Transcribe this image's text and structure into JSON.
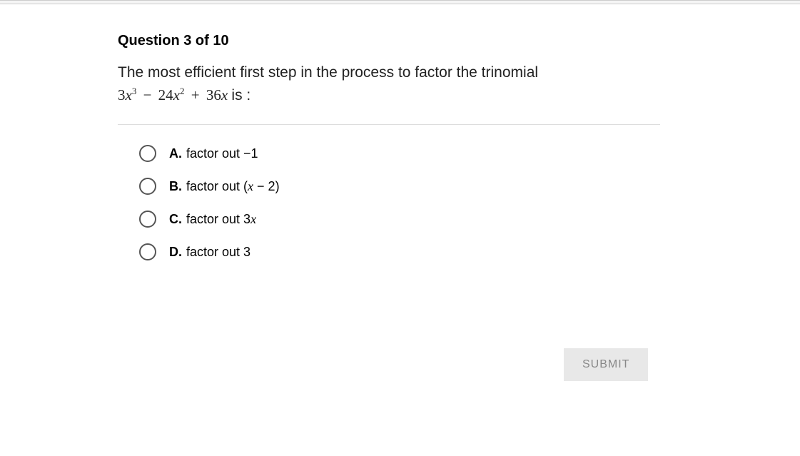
{
  "question": {
    "header": "Question 3 of 10",
    "text": "The most efficient first step in the process to factor the trinomial",
    "expression_suffix": " is :",
    "expression": {
      "coef1": "3",
      "var1": "x",
      "exp1": "3",
      "op1": "−",
      "coef2": "24",
      "var2": "x",
      "exp2": "2",
      "op2": "+",
      "coef3": "36",
      "var3": "x"
    }
  },
  "options": {
    "a": {
      "letter": "A.",
      "text": "factor out −1"
    },
    "b": {
      "letter": "B.",
      "prefix": "factor out (",
      "var": "x",
      "suffix": " − 2)"
    },
    "c": {
      "letter": "C.",
      "prefix": "factor out 3",
      "var": "x"
    },
    "d": {
      "letter": "D.",
      "text": "factor out 3"
    }
  },
  "submit": {
    "label": "SUBMIT"
  }
}
